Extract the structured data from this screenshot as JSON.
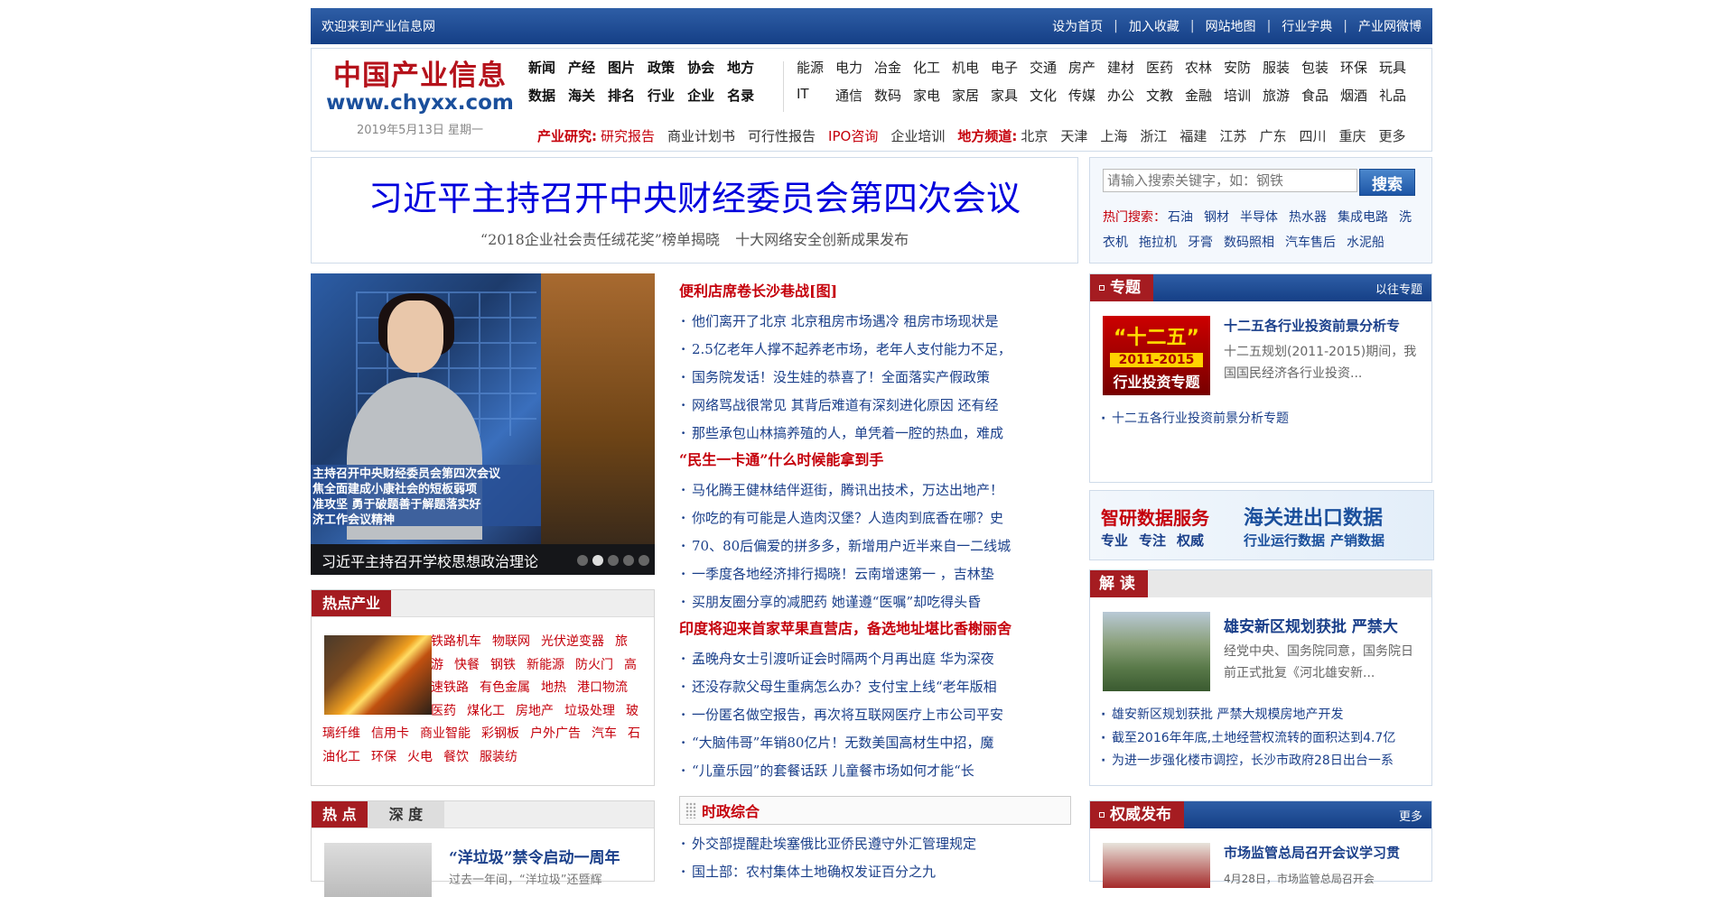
{
  "topbar": {
    "welcome": "欢迎来到产业信息网",
    "links": [
      "设为首页",
      "加入收藏",
      "网站地图",
      "行业字典",
      "产业网微博"
    ]
  },
  "logo": {
    "cn": "中国产业信息",
    "en": "www.chyxx.com",
    "date": "2019年5月13日  星期一"
  },
  "nav": {
    "main_row1": [
      "新闻",
      "产经",
      "图片",
      "政策",
      "协会",
      "地方"
    ],
    "main_row2": [
      "数据",
      "海关",
      "排名",
      "行业",
      "企业",
      "名录"
    ],
    "ind_row1": [
      "能源",
      "电力",
      "冶金",
      "化工",
      "机电",
      "电子",
      "交通",
      "房产",
      "建材",
      "医药",
      "农林",
      "安防",
      "服装",
      "包装",
      "环保",
      "玩具"
    ],
    "ind_row2": [
      "IT",
      "通信",
      "数码",
      "家电",
      "家居",
      "家具",
      "文化",
      "传媒",
      "办公",
      "文教",
      "金融",
      "培训",
      "旅游",
      "食品",
      "烟酒",
      "礼品"
    ],
    "research_label": "产业研究:",
    "research_items": [
      {
        "label": "研究报告",
        "red": true
      },
      {
        "label": "商业计划书",
        "red": false
      },
      {
        "label": "可行性报告",
        "red": false
      },
      {
        "label": "IPO咨询",
        "red": true
      },
      {
        "label": "企业培训",
        "red": false
      }
    ],
    "region_label": "地方频道:",
    "region_items": [
      "北京",
      "天津",
      "上海",
      "浙江",
      "福建",
      "江苏",
      "广东",
      "四川",
      "重庆",
      "更多"
    ]
  },
  "headline": {
    "title": "习近平主持召开中央财经委员会第四次会议",
    "sub1": "“2018企业社会责任绒花奖”榜单揭晓",
    "sub2": "十大网络安全创新成果发布"
  },
  "search": {
    "placeholder": "请输入搜索关键字，如：钢铁",
    "button": "搜索",
    "hot_label": "热门搜索：",
    "hot_items": [
      "石油",
      "钢材",
      "半导体",
      "热水器",
      "集成电路",
      "洗衣机",
      "拖拉机",
      "牙膏",
      "数码照相",
      "汽车售后",
      "水泥船"
    ]
  },
  "slideshow": {
    "ticker": [
      "主持召开中央财经委员会第四次会议",
      "焦全面建成小康社会的短板弱项",
      "准攻坚 勇于破题善于解题落实好",
      "济工作会议精神"
    ],
    "caption": "习近平主持召开学校思想政治理论",
    "dots": 5,
    "active_dot": 2
  },
  "news": [
    {
      "title": "便利店席卷长沙巷战[图]",
      "items": [
        "他们离开了北京 北京租房市场遇冷 租房市场现状是",
        "2.5亿老年人撑不起养老市场，老年人支付能力不足，",
        "国务院发话！没生娃的恭喜了！全面落实产假政策",
        "网络骂战很常见 其背后难道有深刻进化原因 还有经",
        "那些承包山林搞养殖的人，单凭着一腔的热血，难成"
      ]
    },
    {
      "title": "“民生一卡通”什么时候能拿到手",
      "items": [
        "马化腾王健林结伴逛街，腾讯出技术，万达出地产！",
        "你吃的有可能是人造肉汉堡？人造肉到底香在哪？史",
        "70、80后偏爱的拼多多，新增用户近半来自一二线城",
        "一季度各地经济排行揭晓！云南增速第一 ，吉林垫",
        "买朋友圈分享的减肥药 她谨遵“医嘱”却吃得头昏"
      ]
    },
    {
      "title": "印度将迎来首家苹果直营店，备选地址堪比香榭丽舍",
      "items": [
        "孟晚舟女士引渡听证会时隔两个月再出庭 华为深夜",
        "还没存款父母生重病怎么办？支付宝上线“老年版相",
        "一份匿名做空报告，再次将互联网医疗上市公司平安",
        "“大脑伟哥”年销80亿片！无数美国高材生中招，魔",
        "“儿童乐园”的套餐话跃 儿童餐市场如何才能“长"
      ]
    }
  ],
  "szzh": {
    "title": "时政综合",
    "items": [
      "外交部提醒赴埃塞俄比亚侨民遵守外汇管理规定",
      "国土部：农村集体土地确权发证百分之九"
    ]
  },
  "hot_industry": {
    "tab": "热点产业",
    "tags": [
      "铁路机车",
      "物联网",
      "光伏逆变器",
      "旅游",
      "快餐",
      "钢铁",
      "新能源",
      "防火门",
      "高速铁路",
      "有色金属",
      "地热",
      "港口物流",
      "医药",
      "煤化工",
      "房地产",
      "垃圾处理",
      "玻璃纤维",
      "信用卡",
      "商业智能",
      "彩钢板",
      "户外广告",
      "汽车",
      "石油化工",
      "环保",
      "火电",
      "餐饮",
      "服装纺"
    ]
  },
  "hot_deep": {
    "tab1": "热 点",
    "tab2": "深 度",
    "title": "“洋垃圾”禁令启动一周年",
    "desc": "过去一年间，“洋垃圾”还暨辉"
  },
  "zhuanti": {
    "label": "专题",
    "more": "以往专题",
    "img_a": "“十二五”",
    "img_b": "2011-2015",
    "img_c": "行业投资专题",
    "title": "十二五各行业投资前景分析专",
    "desc": "十二五规划(2011-2015)期间，我国国民经济各行业投资...",
    "list": [
      "十二五各行业投资前景分析专题"
    ]
  },
  "banner": {
    "left_title": "智研数据服务",
    "left_tags": [
      "专业",
      "专注",
      "权威"
    ],
    "right_title": "海关进出口数据",
    "right_tags": [
      "行业运行数据",
      "产销数据"
    ]
  },
  "jiedu": {
    "label": "解 读",
    "title": "雄安新区规划获批 严禁大",
    "desc": "经党中央、国务院同意，国务院日前正式批复《河北雄安新...",
    "list": [
      "雄安新区规划获批 严禁大规模房地产开发",
      "截至2016年年底,土地经营权流转的面积达到4.7亿",
      "为进一步强化楼市调控，长沙市政府28日出台一系"
    ]
  },
  "quanwei": {
    "label": "权威发布",
    "more": "更多",
    "title": "市场监管总局召开会议学习贯",
    "desc": "4月28日，市场监管总局召开会"
  },
  "colors": {
    "brand_blue": "#1a4f9c",
    "brand_red": "#c5000b",
    "link_blue": "#1a3f8a"
  }
}
